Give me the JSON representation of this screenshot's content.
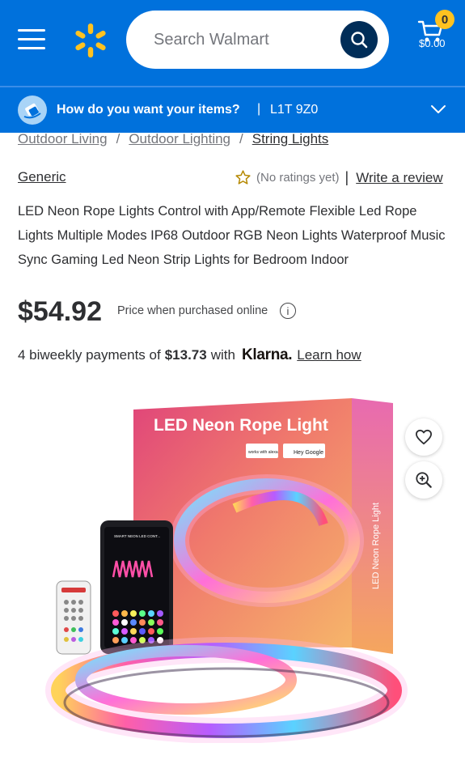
{
  "header": {
    "search_placeholder": "Search Walmart",
    "cart_count": "0",
    "cart_total": "$0.00",
    "colors": {
      "brand_blue": "#0071dc",
      "spark_yellow": "#ffc220",
      "search_button": "#002d58"
    }
  },
  "delivery": {
    "question": "How do you want your items?",
    "separator": "|",
    "postal_code": "L1T 9Z0"
  },
  "breadcrumb": {
    "items": [
      "Outdoor Living",
      "Outdoor Lighting",
      "String Lights"
    ],
    "separator": "/"
  },
  "product": {
    "brand": "Generic",
    "rating_text": "(No ratings yet)",
    "rating_separator": "|",
    "write_review": "Write a review",
    "title": "LED Neon Rope Lights Control with App/Remote Flexible Led Rope Lights Multiple Modes IP68 Outdoor RGB Neon Lights Waterproof Music Sync Gaming Led Neon Strip Lights for Bedroom Indoor",
    "price": "$54.92",
    "price_note": "Price when purchased online",
    "info_glyph": "i"
  },
  "klarna": {
    "prefix": "4 biweekly payments of",
    "amount": "$13.73",
    "with": "with",
    "logo": "Klarna.",
    "learn_how": "Learn how"
  },
  "image": {
    "box_title": "LED Neon Rope Light",
    "box_side": "LED Neon Rope Light",
    "badge_alexa": "works with alexa",
    "badge_google": "Hey Google",
    "phone_header": "SMART NEON LED CONT..."
  },
  "icons": {
    "menu": "hamburger-icon",
    "spark": "walmart-spark-icon",
    "search": "search-icon",
    "cart": "cart-icon",
    "delivery": "delivery-options-icon",
    "chevron": "chevron-down-icon",
    "star": "star-outline-icon",
    "favorite": "heart-icon",
    "zoom": "zoom-in-icon"
  }
}
